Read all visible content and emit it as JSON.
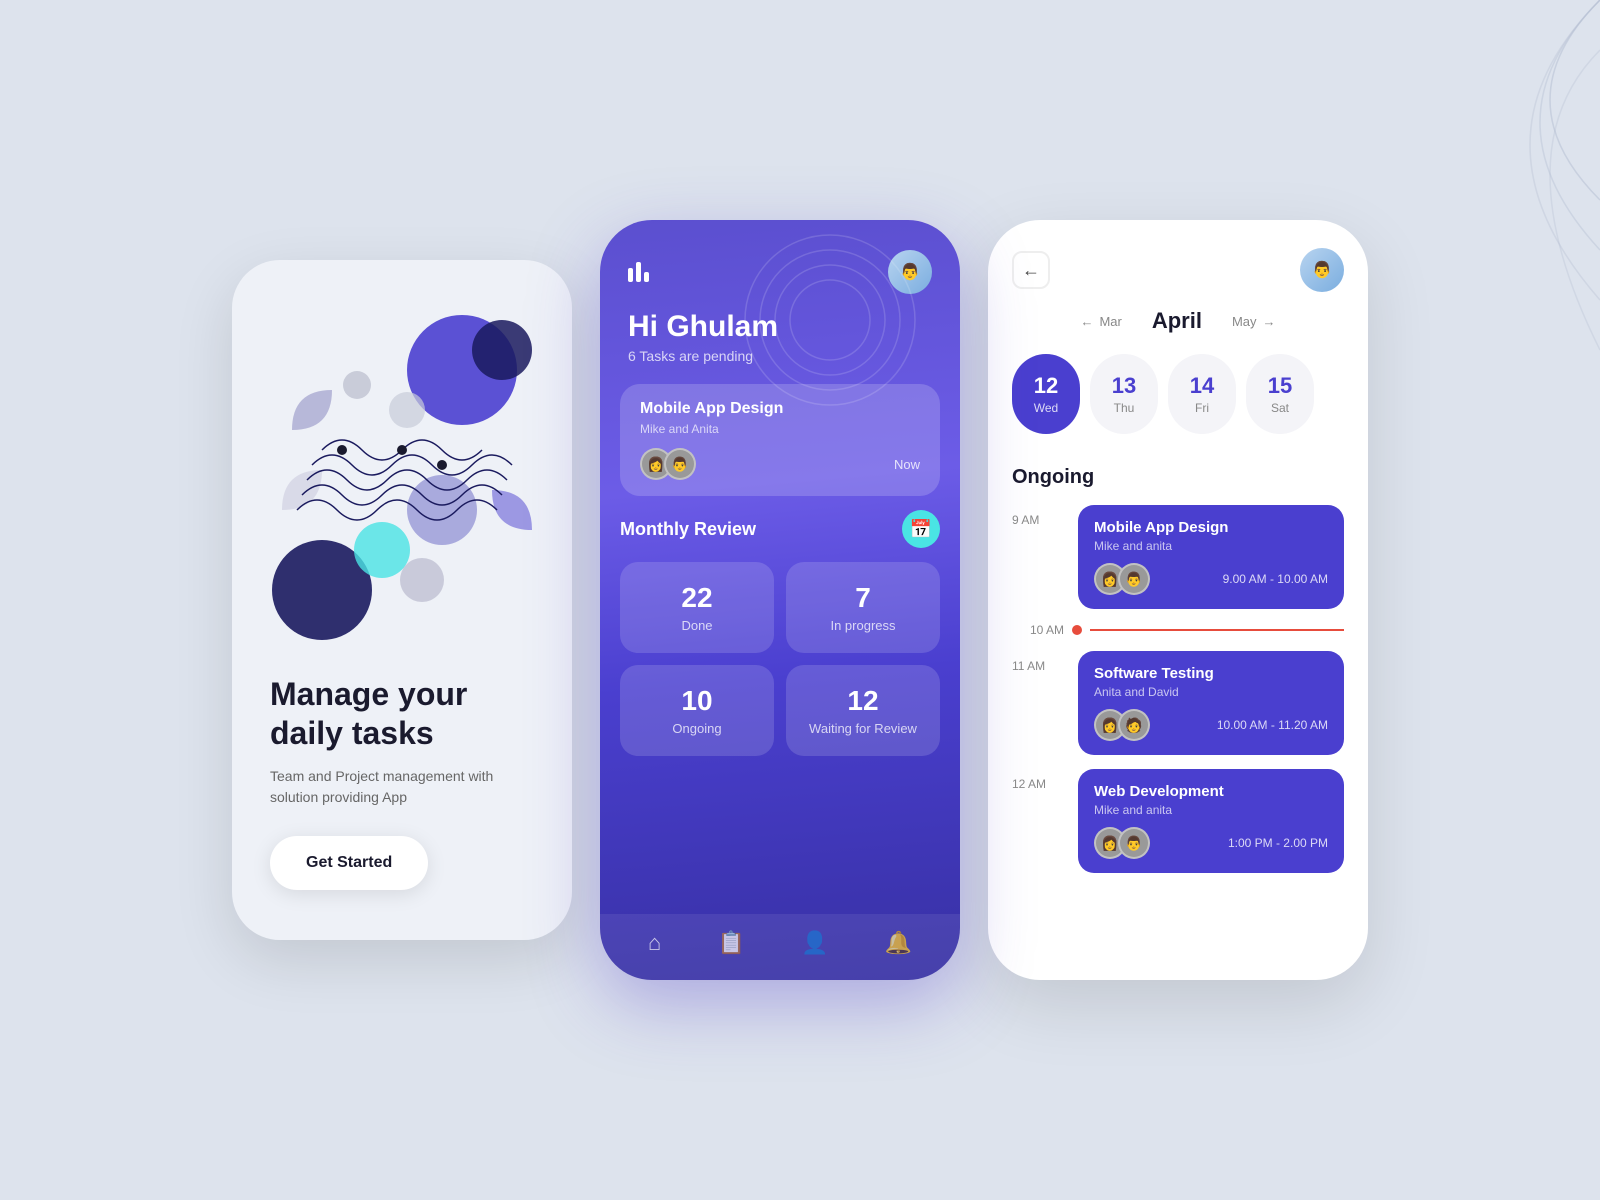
{
  "background_color": "#dde3ed",
  "phone1": {
    "title": "Manage your daily tasks",
    "subtitle": "Team and Project management with solution providing App",
    "cta_label": "Get Started"
  },
  "phone2": {
    "greeting": "Hi Ghulam",
    "pending": "6 Tasks are pending",
    "task": {
      "title": "Mobile App Design",
      "participants": "Mike and Anita",
      "time": "Now"
    },
    "monthly_review": {
      "title": "Monthly Review",
      "stats": [
        {
          "number": "22",
          "label": "Done"
        },
        {
          "number": "7",
          "label": "In progress"
        },
        {
          "number": "10",
          "label": "Ongoing"
        },
        {
          "number": "12",
          "label": "Waiting for Review"
        }
      ]
    },
    "nav_icons": [
      "🏠",
      "📄",
      "👤",
      "🔔"
    ]
  },
  "phone3": {
    "month": "April",
    "prev_month": "Mar",
    "next_month": "May",
    "days": [
      {
        "num": "12",
        "name": "Wed",
        "active": true
      },
      {
        "num": "13",
        "name": "Thu",
        "active": false
      },
      {
        "num": "14",
        "name": "Fri",
        "active": false
      },
      {
        "num": "15",
        "name": "Sat",
        "active": false
      }
    ],
    "section_title": "Ongoing",
    "current_time": "10 AM",
    "events": [
      {
        "time": "9 AM",
        "title": "Mobile App Design",
        "participants": "Mike and anita",
        "time_range": "9.00 AM - 10.00 AM"
      },
      {
        "time": "11 AM",
        "title": "Software Testing",
        "participants": "Anita and David",
        "time_range": "10.00 AM - 11.20 AM"
      },
      {
        "time": "12 AM",
        "title": "Web Development",
        "participants": "Mike and anita",
        "time_range": "1:00 PM - 2.00 PM"
      }
    ]
  }
}
